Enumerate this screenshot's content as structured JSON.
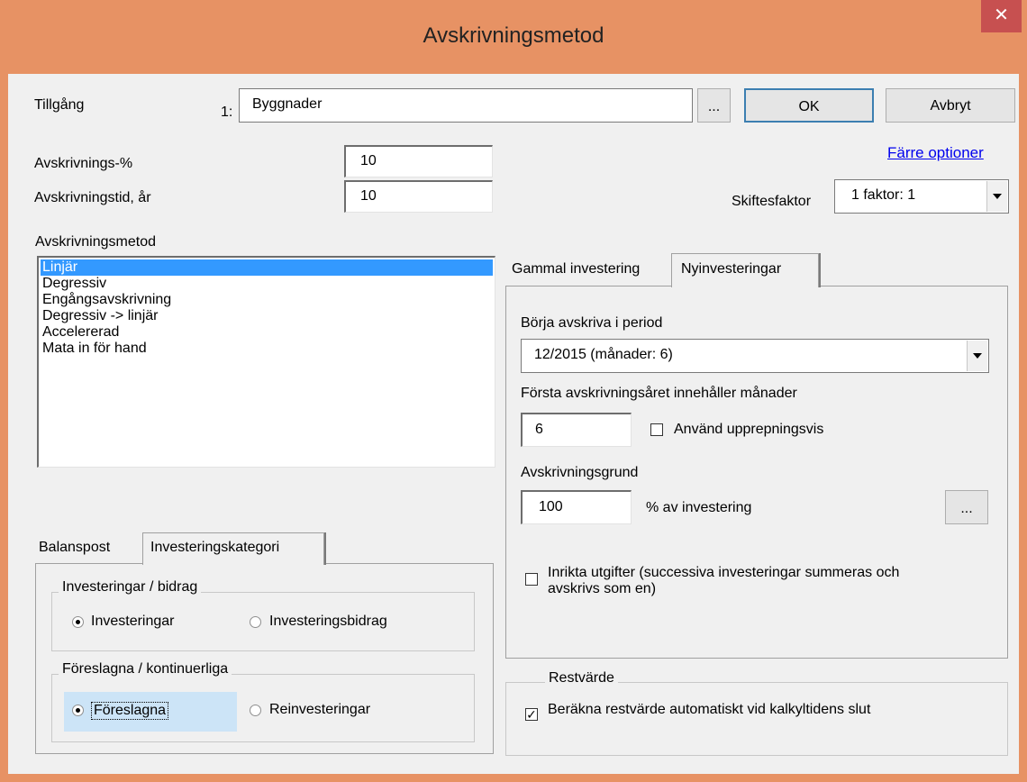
{
  "window": {
    "title": "Avskrivningsmetod",
    "close_glyph": "✕"
  },
  "asset": {
    "label": "Tillgång",
    "index": "1:",
    "value": "Byggnader",
    "browse_label": "..."
  },
  "buttons": {
    "ok": "OK",
    "cancel": "Avbryt"
  },
  "fewer_options_link": "Färre optioner",
  "rate": {
    "label": "Avskrivnings-%",
    "value": "10"
  },
  "term": {
    "label": "Avskrivningstid, år",
    "value": "10"
  },
  "shift_factor": {
    "label": "Skiftesfaktor",
    "value": "1 faktor: 1"
  },
  "method": {
    "label": "Avskrivningsmetod",
    "items": [
      "Linjär",
      "Degressiv",
      "Engångsavskrivning",
      "Degressiv -> linjär",
      "Accelererad",
      "Mata in för hand"
    ],
    "selected": "Linjär"
  },
  "left_tabs": {
    "tabs": [
      "Balanspost",
      "Investeringskategori"
    ],
    "active": "Investeringskategori",
    "group1": {
      "title": "Investeringar / bidrag",
      "options": [
        "Investeringar",
        "Investeringsbidrag"
      ],
      "selected": "Investeringar"
    },
    "group2": {
      "title": "Föreslagna / kontinuerliga",
      "options": [
        "Föreslagna",
        "Reinvesteringar"
      ],
      "selected": "Föreslagna"
    }
  },
  "right_tabs": {
    "tabs": [
      "Gammal investering",
      "Nyinvesteringar"
    ],
    "active": "Nyinvesteringar",
    "start_period": {
      "label": "Börja avskriva i period",
      "value": "12/2015 (månader: 6)"
    },
    "first_year": {
      "label": "Första avskrivningsåret innehåller månader",
      "value": "6",
      "repeat_label": "Använd upprepningsvis",
      "repeat_checked": false
    },
    "basis": {
      "label": "Avskrivningsgrund",
      "value": "100",
      "suffix": "% av investering",
      "browse_label": "..."
    },
    "aligned": {
      "label_line1": "Inrikta utgifter (successiva investeringar summeras och",
      "label_line2": "avskrivs som en)",
      "checked": false
    }
  },
  "residual": {
    "title": "Restvärde",
    "label": "Beräkna restvärde automatiskt vid kalkyltidens slut",
    "checked": true,
    "check_glyph": "✓"
  },
  "colors": {
    "frame": "#e79264",
    "selection": "#3399ff",
    "close": "#c75050",
    "link": "#0000ee",
    "focus_bg": "#cce4f7"
  }
}
